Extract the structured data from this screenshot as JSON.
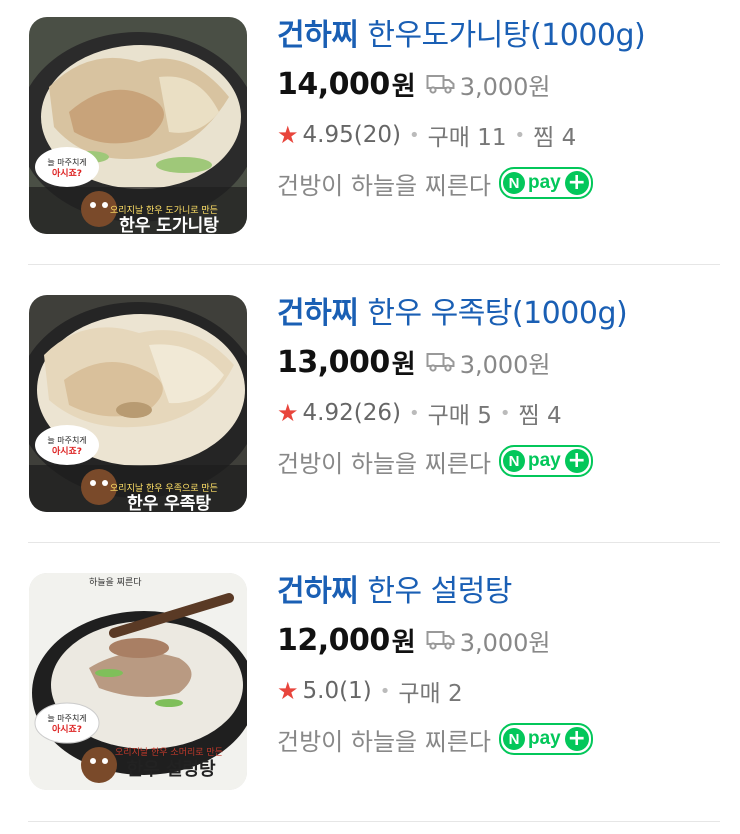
{
  "currency": "원",
  "products": [
    {
      "brand": "건하찌",
      "name": "한우도가니탕(1000g)",
      "price": "14,000",
      "shipping": "3,000원",
      "rating": "4.95",
      "reviews": "(20)",
      "purchases": "구매 11",
      "wishes": "찜 4",
      "store": "건방이 하늘을 찌른다",
      "npay": "pay",
      "thumb_caption": "오리지날 한우 도가니로 만든",
      "thumb_title": "한우 도가니탕"
    },
    {
      "brand": "건하찌",
      "name": "한우 우족탕(1000g)",
      "price": "13,000",
      "shipping": "3,000원",
      "rating": "4.92",
      "reviews": "(26)",
      "purchases": "구매 5",
      "wishes": "찜 4",
      "store": "건방이 하늘을 찌른다",
      "npay": "pay",
      "thumb_caption": "오리지날 한우 우족으로 만든",
      "thumb_title": "한우 우족탕"
    },
    {
      "brand": "건하찌",
      "name": "한우 설렁탕",
      "price": "12,000",
      "shipping": "3,000원",
      "rating": "5.0",
      "reviews": "(1)",
      "purchases": "구매 2",
      "wishes": "",
      "store": "건방이 하늘을 찌른다",
      "npay": "pay",
      "thumb_caption": "오리지날 한우 소머리로 만든",
      "thumb_title": "한우 설렁탕"
    }
  ],
  "colors": {
    "brand_blue": "#1a5fb4",
    "star_red": "#e8453c",
    "npay_green": "#03c75a"
  },
  "icons": {
    "shipping": "truck-icon",
    "rating": "star-icon",
    "npay": "npay-plus-icon"
  }
}
